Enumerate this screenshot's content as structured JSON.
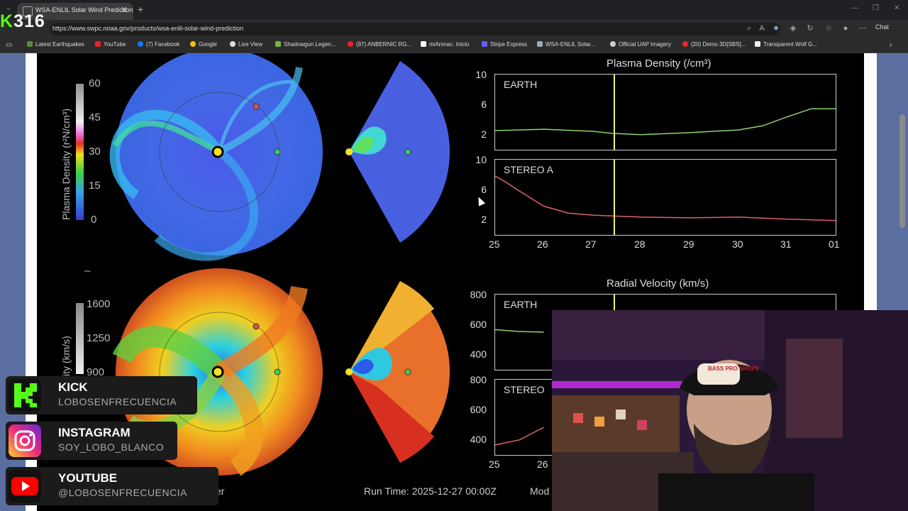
{
  "browser": {
    "tab_title": "WSA-ENLIL Solar Wind Prediction",
    "url": "https://www.swpc.noaa.gov/products/wsa-enlil-solar-wind-prediction",
    "chat_label": "Chat",
    "bookmarks": [
      "Latest Earthquakes",
      "YouTube",
      "(7) Facebook",
      "Google",
      "Live View",
      "Shadowgun Legen...",
      "(97) ANBERNIC RG...",
      "miAnmac. Inicio",
      "Stripe Express",
      "WSA-ENLIL Solar...",
      "Official UAP Imagery",
      "(20) Demo 3D[SBS]...",
      "Transparent Wolf G..."
    ]
  },
  "overlay": {
    "kick_count": "316",
    "kick_prefix": "K"
  },
  "enlil": {
    "density_cbar_label": "Plasma Density (r²N/cm³)",
    "density_cbar_ticks": [
      "60",
      "45",
      "30",
      "15",
      "0"
    ],
    "velocity_cbar_label": "ity (km/s)",
    "velocity_cbar_ticks": [
      "1600",
      "1250",
      "900"
    ],
    "density_title": "Plasma Density (/cm³)",
    "velocity_title": "Radial Velocity (km/s)",
    "earth_label": "EARTH",
    "stereo_a_label": "STEREO A",
    "stereo_cut_label": "STEREO",
    "density_yticks": [
      "10",
      "6",
      "2"
    ],
    "velocity_yticks": [
      "800",
      "600",
      "400"
    ],
    "xticks": [
      "25",
      "26",
      "27",
      "28",
      "29",
      "30",
      "31",
      "01"
    ],
    "xticks_partial": [
      "25",
      "26"
    ],
    "run_time": "Run Time: 2025-12-27 00:00Z",
    "mod_cut": "Mod",
    "cut_er": "er",
    "dash": "–"
  },
  "chart_data": [
    {
      "type": "line",
      "title": "Plasma Density (/cm³)",
      "series": [
        {
          "name": "EARTH",
          "x": [
            25,
            26,
            27,
            27.4,
            28,
            29,
            30,
            30.5,
            31,
            31.5,
            32
          ],
          "y": [
            2.8,
            3.0,
            2.7,
            2.4,
            2.2,
            2.5,
            2.9,
            3.5,
            4.8,
            6.0,
            6.0
          ]
        }
      ],
      "ylim": [
        0,
        11
      ],
      "color": "#8ed36b"
    },
    {
      "type": "line",
      "series": [
        {
          "name": "STEREO A",
          "x": [
            25,
            25.2,
            25.5,
            26,
            26.5,
            27,
            28,
            29,
            30,
            31,
            32
          ],
          "y": [
            8.6,
            7.8,
            6.4,
            4.2,
            3.2,
            2.9,
            2.6,
            2.5,
            2.6,
            2.3,
            2.1
          ]
        }
      ],
      "ylim": [
        0,
        11
      ],
      "color": "#e06070"
    },
    {
      "type": "line",
      "title": "Radial Velocity (km/s)",
      "series": [
        {
          "name": "EARTH",
          "x": [
            25,
            25.5,
            26,
            26.6
          ],
          "y": [
            620,
            605,
            600,
            600
          ]
        }
      ],
      "ylim": [
        300,
        900
      ],
      "color": "#8ed36b"
    },
    {
      "type": "line",
      "series": [
        {
          "name": "STEREO",
          "x": [
            25,
            25.5,
            26,
            26.6
          ],
          "y": [
            380,
            420,
            520,
            620
          ]
        }
      ],
      "ylim": [
        300,
        900
      ],
      "color": "#e06070"
    }
  ],
  "timeline_marker_day": 27.45,
  "social": [
    {
      "name": "KICK",
      "handle": "LOBOSENFRECUENCIA"
    },
    {
      "name": "INSTAGRAM",
      "handle": "SOY_LOBO_BLANCO"
    },
    {
      "name": "YOUTUBE",
      "handle": "@LOBOSENFRECUENCIA"
    }
  ],
  "webcam": {
    "cap_text": "BASS PRO SHOPS"
  }
}
